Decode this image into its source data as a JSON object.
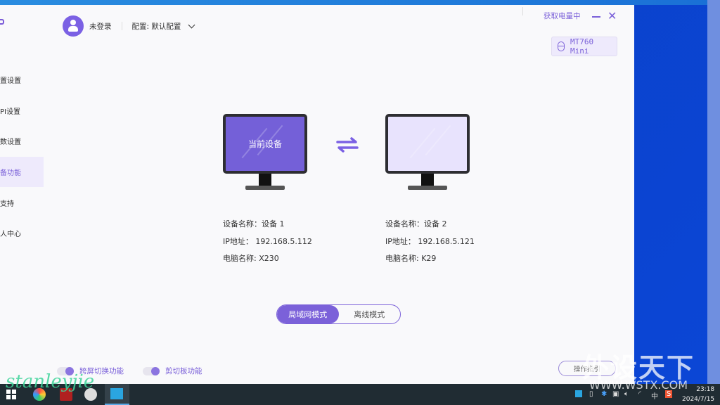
{
  "header": {
    "user": "未登录",
    "config": "配置: 默认配置",
    "battery_status": "获取电量中",
    "device_badge": "MT760 Mini"
  },
  "sidebar": {
    "items": [
      {
        "label": "置设置"
      },
      {
        "label": "PI设置"
      },
      {
        "label": "数设置"
      },
      {
        "label": "设备功能",
        "active": true
      },
      {
        "label": "支持"
      },
      {
        "label": "人中心"
      }
    ]
  },
  "devices": [
    {
      "screen_label": "当前设备",
      "name": "设备名称：设备 1",
      "ip": "IP地址： 192.168.5.112",
      "pc": "电脑名称: X230",
      "current": true
    },
    {
      "screen_label": "",
      "name": "设备名称：设备 2",
      "ip": "IP地址： 192.168.5.121",
      "pc": "电脑名称: K29",
      "current": false
    }
  ],
  "mode": {
    "options": [
      "局域网模式",
      "离线模式"
    ],
    "selected": "局域网模式"
  },
  "toggles": [
    {
      "label": "跨屏切换功能",
      "on": true
    },
    {
      "label": "剪切板功能",
      "on": true
    }
  ],
  "guide_button": "操作指引",
  "taskbar": {
    "time": "23:18",
    "date": "2024/7/15",
    "ime": "中"
  },
  "watermarks": {
    "signature": "stanleyjie",
    "site": "外设天下",
    "url": "WWW.WSTX.COM"
  },
  "colors": {
    "accent": "#7b61d9",
    "current_screen": "#7460d8",
    "other_screen": "#e8e3fd"
  }
}
